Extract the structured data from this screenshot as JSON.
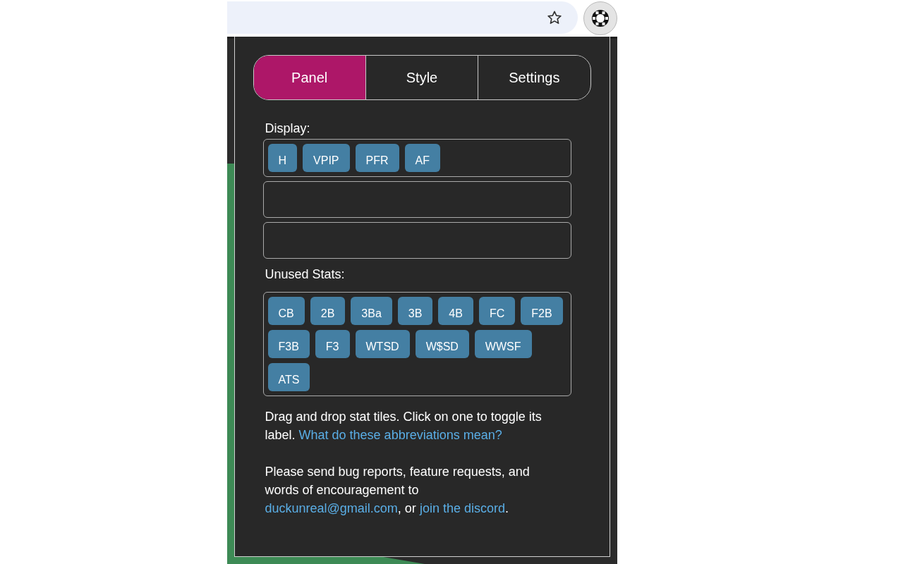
{
  "tabs": [
    {
      "label": "Panel",
      "selected": true
    },
    {
      "label": "Style",
      "selected": false
    },
    {
      "label": "Settings",
      "selected": false
    }
  ],
  "display": {
    "label": "Display:",
    "rows": [
      {
        "tiles": [
          "H",
          "VPIP",
          "PFR",
          "AF"
        ]
      },
      {
        "tiles": []
      },
      {
        "tiles": []
      }
    ]
  },
  "unused": {
    "label": "Unused Stats:",
    "tiles": [
      "CB",
      "2B",
      "3Ba",
      "3B",
      "4B",
      "FC",
      "F2B",
      "F3B",
      "F3",
      "WTSD",
      "W$SD",
      "WWSF",
      "ATS"
    ]
  },
  "help": {
    "text": "Drag and drop stat tiles. Click on one to toggle its label.",
    "link": "What do these abbreviations mean?"
  },
  "contact": {
    "text": "Please send bug reports, feature requests, and words of encouragement to",
    "email": "duckunreal@gmail.com",
    "between": ", or",
    "link": "join the discord",
    "end": "."
  }
}
